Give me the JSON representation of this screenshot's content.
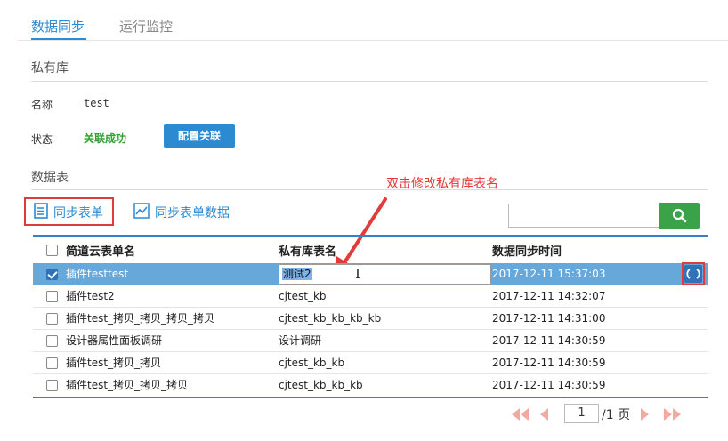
{
  "tabs": [
    {
      "label": "数据同步",
      "active": true
    },
    {
      "label": "运行监控",
      "active": false
    }
  ],
  "private_lib": {
    "section_title": "私有库",
    "name_label": "名称",
    "name_value": "test",
    "status_label": "状态",
    "status_value": "关联成功",
    "config_button": "配置关联"
  },
  "data_table": {
    "section_title": "数据表",
    "annotation": "双击修改私有库表名",
    "sync_form_button": "同步表单",
    "sync_data_button": "同步表单数据",
    "search_placeholder": "",
    "columns": [
      "简道云表单名",
      "私有库表名",
      "数据同步时间"
    ],
    "rows": [
      {
        "form": "插件testtest",
        "table": "测试2",
        "time": "2017-12-11 15:37:03",
        "checked": true,
        "editing": true
      },
      {
        "form": "插件test2",
        "table": "cjtest_kb",
        "time": "2017-12-11 14:32:07",
        "checked": false
      },
      {
        "form": "插件test_拷贝_拷贝_拷贝_拷贝",
        "table": "cjtest_kb_kb_kb_kb",
        "time": "2017-12-11 14:31:00",
        "checked": false
      },
      {
        "form": "设计器属性面板调研",
        "table": "设计调研",
        "time": "2017-12-11 14:30:59",
        "checked": false
      },
      {
        "form": "插件test_拷贝_拷贝",
        "table": "cjtest_kb_kb",
        "time": "2017-12-11 14:30:59",
        "checked": false
      },
      {
        "form": "插件test_拷贝_拷贝_拷贝",
        "table": "cjtest_kb_kb_kb",
        "time": "2017-12-11 14:30:59",
        "checked": false
      }
    ]
  },
  "pagination": {
    "current_page": "1",
    "total_text": "/1 页"
  },
  "colors": {
    "accent": "#2b8ad0",
    "success": "#2fa22f",
    "annotation": "#e33b3b",
    "selected_row": "#67a8da",
    "search_button": "#3aa34a"
  }
}
